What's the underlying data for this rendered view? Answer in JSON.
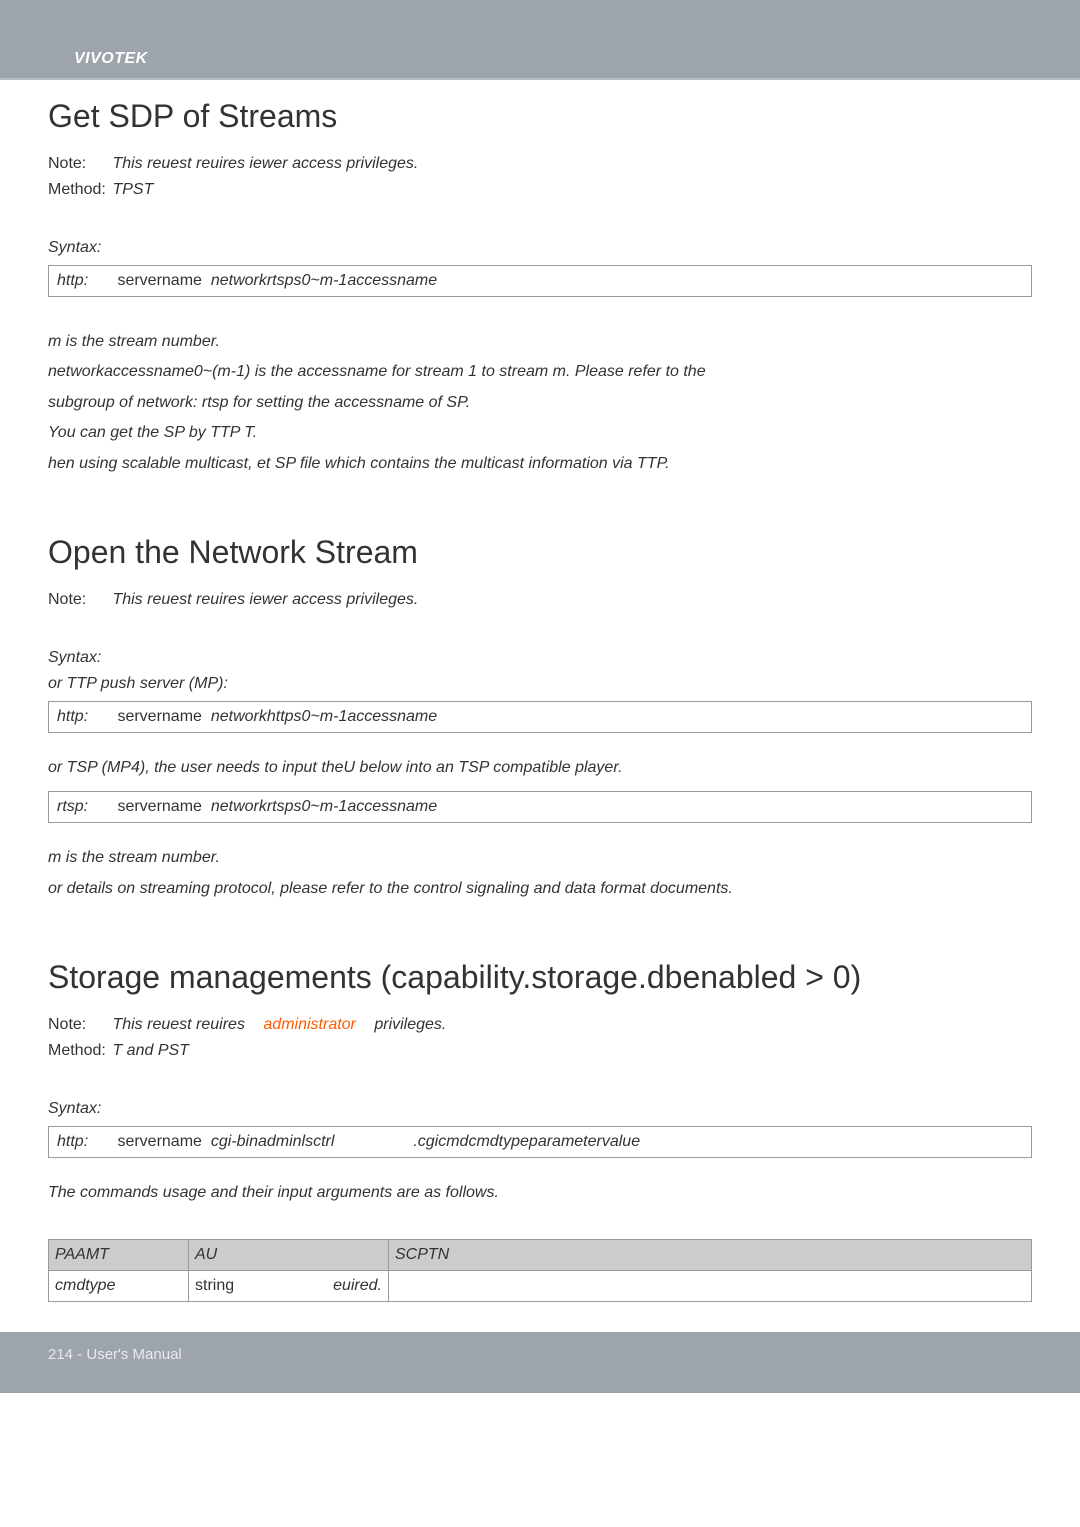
{
  "header": {
    "brand": "VIVOTEK"
  },
  "sec1": {
    "title": "Get SDP of Streams",
    "note_label": "Note:",
    "note_text": "This reuest reuires iewer access privileges.",
    "method_label": "Method:",
    "method_text": "TPST",
    "syntax_label": "Syntax:",
    "code_proto": "http:",
    "code_server": "servername",
    "code_path": "networkrtsps0~m-1accessname",
    "p1": "m is the stream number.",
    "p2": "networkaccessname0~(m-1) is the accessname for stream 1 to stream m. Please refer to the",
    "p3": "subgroup of network: rtsp for setting the accessname of SP.",
    "p4": "You can get the SP by TTP T.",
    "p5": "hen using scalable multicast, et SP file which contains the multicast information via TTP."
  },
  "sec2": {
    "title": "Open the Network Stream",
    "note_label": "Note:",
    "note_text": "This reuest reuires iewer access privileges.",
    "syntax_label": "Syntax:",
    "push_label": "or TTP push server (MP):",
    "code1_proto": "http:",
    "code1_server": "servername",
    "code1_path": "networkhttps0~m-1accessname",
    "rtsp_label": "or TSP (MP4), the user needs to input theU below into an TSP compatible player.",
    "code2_proto": "rtsp:",
    "code2_server": "servername",
    "code2_path": "networkrtsps0~m-1accessname",
    "p1": "m is the stream number.",
    "p2": "or details on streaming protocol, please refer to the control signaling and data format documents."
  },
  "sec3": {
    "title": "Storage managements (capability.storage.dbenabled > 0)",
    "note_label": "Note:",
    "note_text1": "This reuest reuires",
    "note_admin": "administrator",
    "note_text2": "privileges.",
    "method_label": "Method:",
    "method_text": "T and PST",
    "syntax_label": "Syntax:",
    "code_proto": "http:",
    "code_server": "servername",
    "code_path1": "cgi-binadminlsctrl",
    "code_path2": ".cgicmdcmdtypeparametervalue",
    "intro": "The commands usage and their input arguments are as follows.",
    "th1": "PAAMT",
    "th2": "AU",
    "th3": "SCPTN",
    "r1c1": "cmdtype",
    "r1c2a": "string",
    "r1c2b": "euired.",
    "r1c3": ""
  },
  "footer": {
    "text": "214 - User's Manual"
  }
}
